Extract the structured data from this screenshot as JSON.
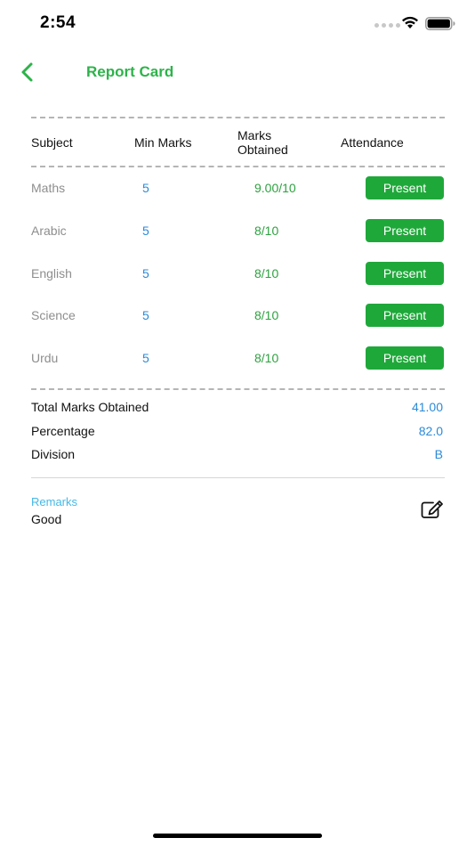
{
  "status_bar": {
    "time": "2:54"
  },
  "header": {
    "title": "Report Card",
    "back_icon": "chevron-left-icon",
    "accent_color": "#2db34a"
  },
  "table": {
    "columns": {
      "subject": "Subject",
      "min_marks": "Min Marks",
      "marks_obtained_line1": "Marks",
      "marks_obtained_line2": "Obtained",
      "attendance": "Attendance"
    },
    "rows": [
      {
        "subject": "Maths",
        "min_marks": "5",
        "obtained": "9.00/10",
        "attendance": "Present"
      },
      {
        "subject": "Arabic",
        "min_marks": "5",
        "obtained": "8/10",
        "attendance": "Present"
      },
      {
        "subject": "English",
        "min_marks": "5",
        "obtained": "8/10",
        "attendance": "Present"
      },
      {
        "subject": "Science",
        "min_marks": "5",
        "obtained": "8/10",
        "attendance": "Present"
      },
      {
        "subject": "Urdu",
        "min_marks": "5",
        "obtained": "8/10",
        "attendance": "Present"
      }
    ]
  },
  "summary": {
    "total_label": "Total Marks Obtained",
    "total_value": "41.00",
    "percentage_label": "Percentage",
    "percentage_value": "82.0",
    "division_label": "Division",
    "division_value": "B"
  },
  "remarks": {
    "label": "Remarks",
    "text": "Good",
    "edit_icon": "edit-icon"
  }
}
